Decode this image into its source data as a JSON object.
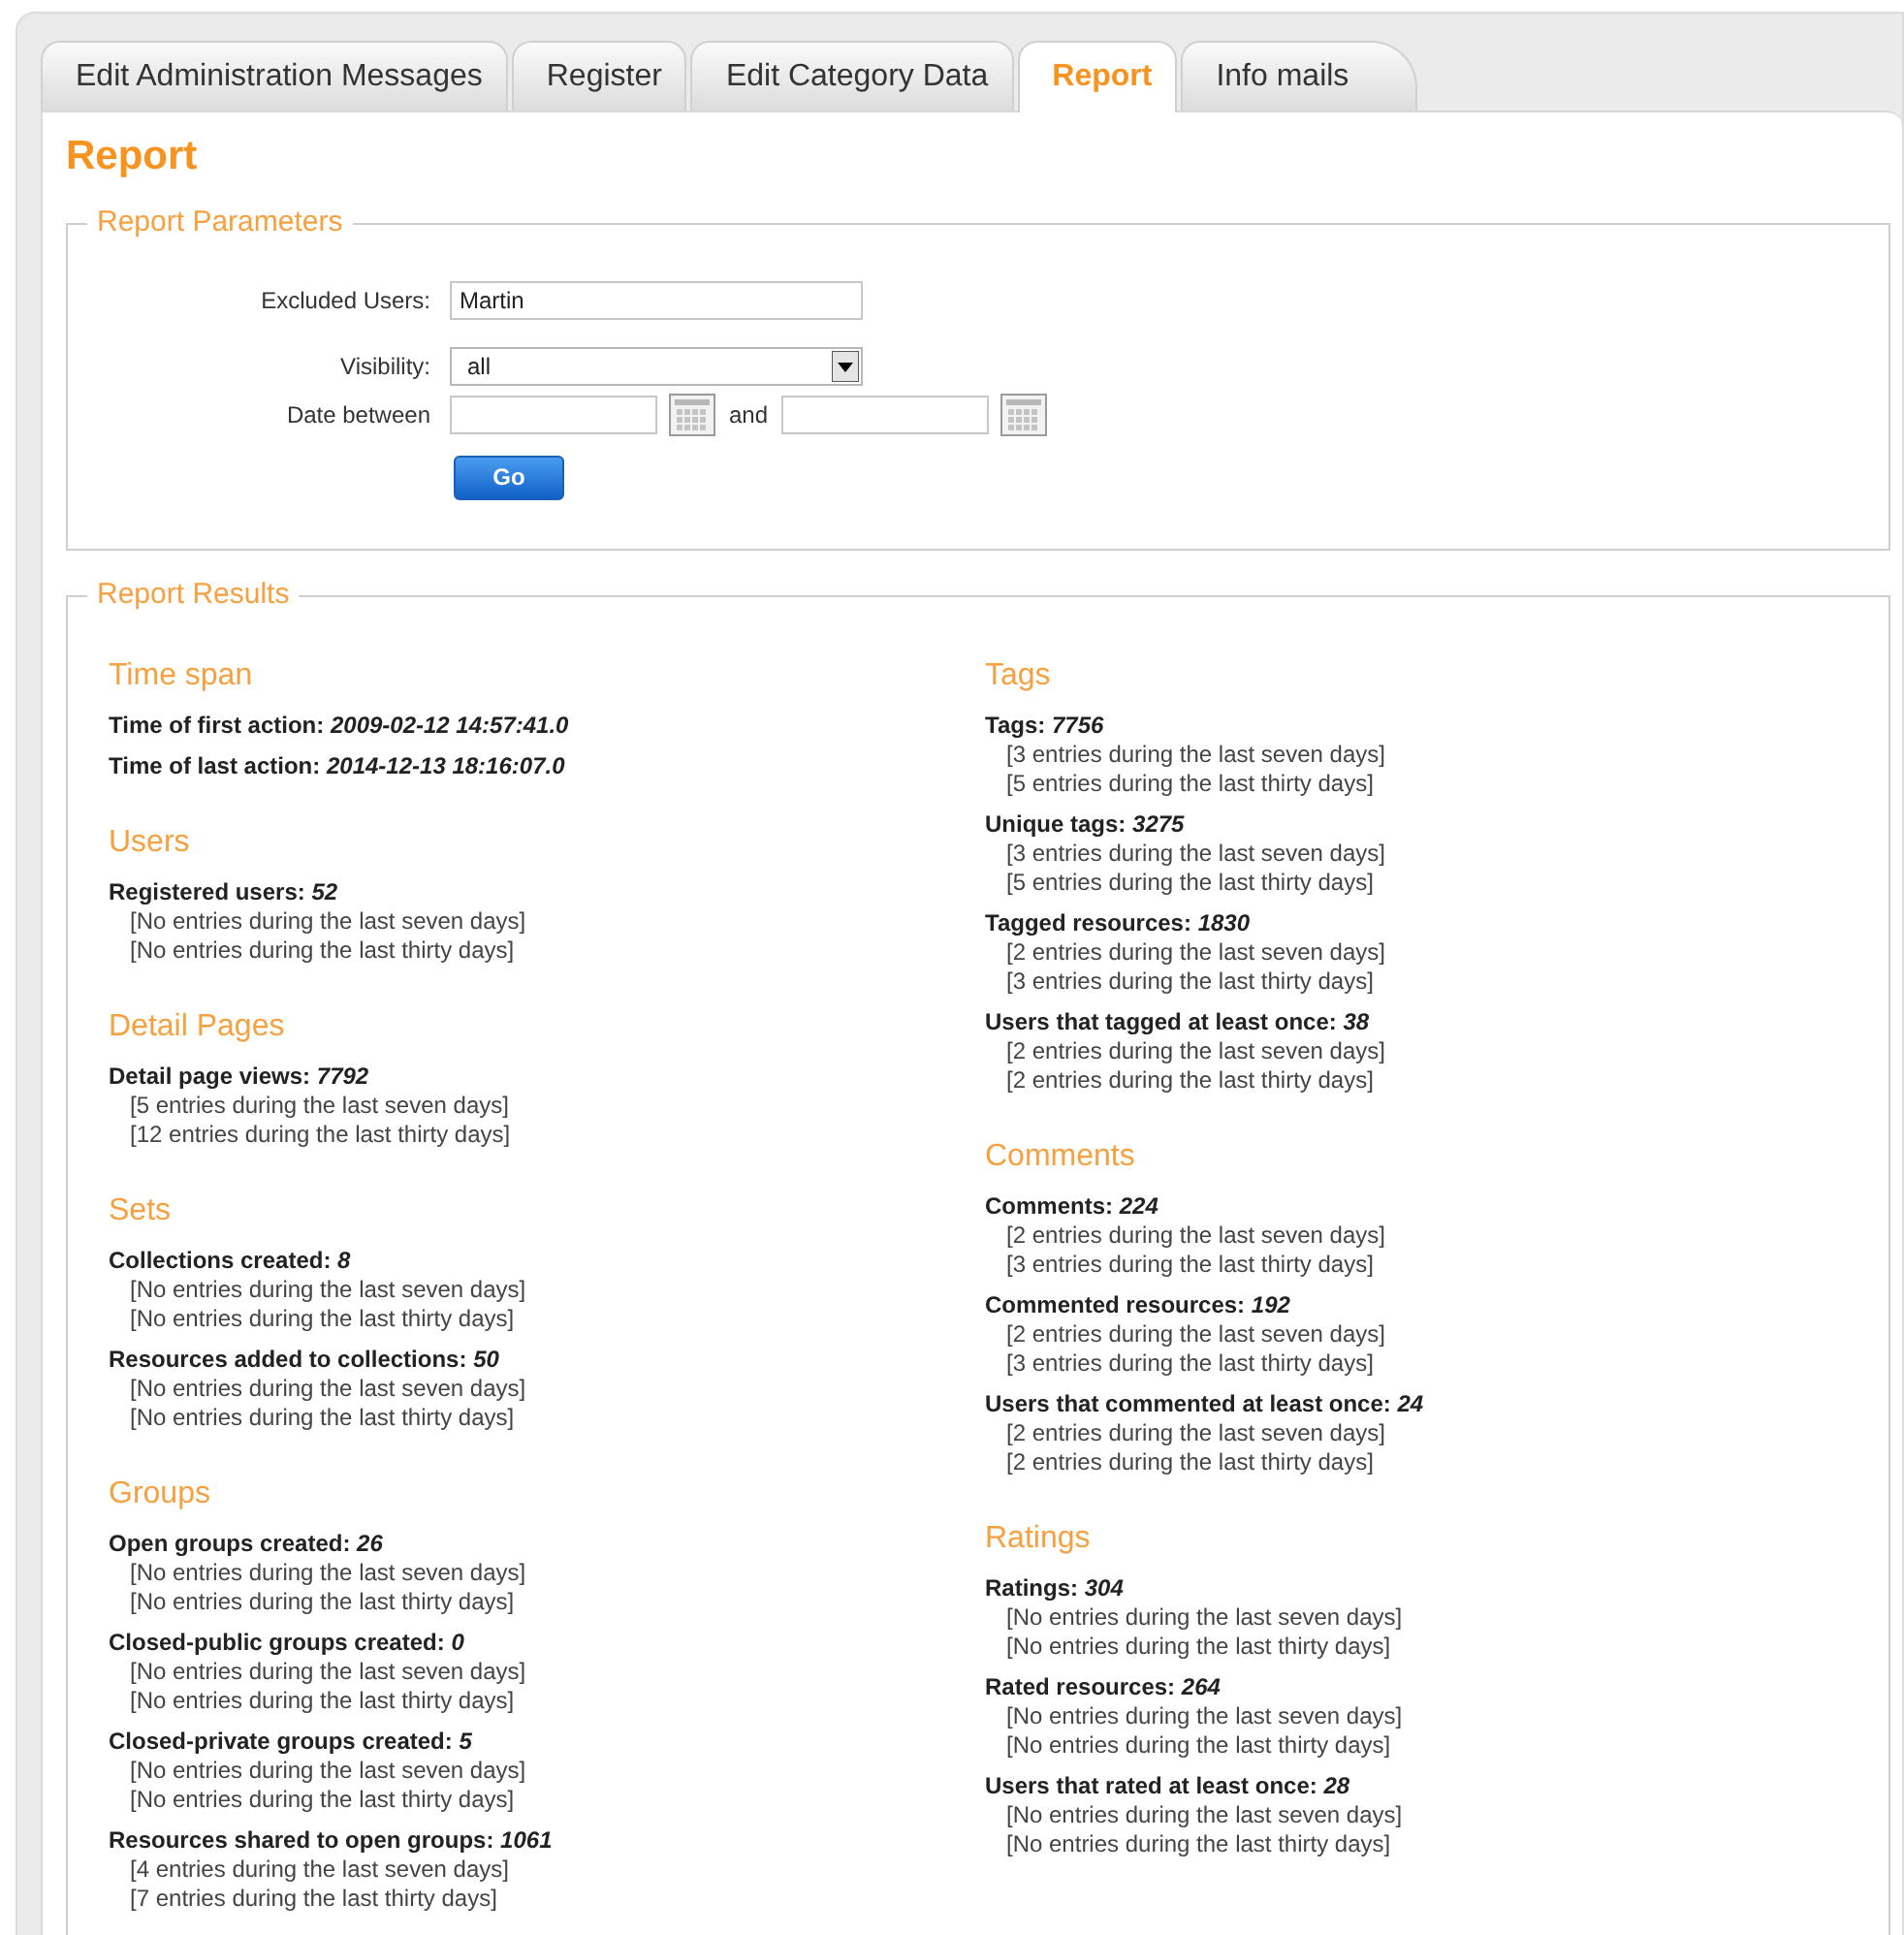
{
  "tabs": [
    {
      "label": "Edit Administration Messages",
      "selected": false
    },
    {
      "label": "Register",
      "selected": false
    },
    {
      "label": "Edit Category Data",
      "selected": false
    },
    {
      "label": "Report",
      "selected": true
    },
    {
      "label": "Info mails",
      "selected": false
    }
  ],
  "page_title": "Report",
  "parameters": {
    "legend": "Report Parameters",
    "excluded_users": {
      "label": "Excluded Users:",
      "value": "Martin"
    },
    "visibility": {
      "label": "Visibility:",
      "value": "all"
    },
    "date": {
      "label": "Date between",
      "joiner": "and"
    },
    "go_button": "Go"
  },
  "results": {
    "legend": "Report Results",
    "columns": [
      [
        {
          "title": "Time span",
          "stats": [
            {
              "label": "Time of first action:",
              "value": "2009-02-12 14:57:41.0"
            },
            {
              "label": "Time of last action:",
              "value": "2014-12-13 18:16:07.0"
            }
          ]
        },
        {
          "title": "Users",
          "stats": [
            {
              "label": "Registered users:",
              "value": "52",
              "lines": [
                "[No entries during the last seven days]",
                "[No entries during the last thirty days]"
              ]
            }
          ]
        },
        {
          "title": "Detail Pages",
          "stats": [
            {
              "label": "Detail page views:",
              "value": "7792",
              "lines": [
                "[5 entries during the last seven days]",
                "[12 entries during the last thirty days]"
              ]
            }
          ]
        },
        {
          "title": "Sets",
          "stats": [
            {
              "label": "Collections created:",
              "value": "8",
              "lines": [
                "[No entries during the last seven days]",
                "[No entries during the last thirty days]"
              ]
            },
            {
              "label": "Resources added to collections:",
              "value": "50",
              "lines": [
                "[No entries during the last seven days]",
                "[No entries during the last thirty days]"
              ]
            }
          ]
        },
        {
          "title": "Groups",
          "stats": [
            {
              "label": "Open groups created:",
              "value": "26",
              "lines": [
                "[No entries during the last seven days]",
                "[No entries during the last thirty days]"
              ]
            },
            {
              "label": "Closed-public groups created:",
              "value": "0",
              "lines": [
                "[No entries during the last seven days]",
                "[No entries during the last thirty days]"
              ]
            },
            {
              "label": "Closed-private groups created:",
              "value": "5",
              "lines": [
                "[No entries during the last seven days]",
                "[No entries during the last thirty days]"
              ]
            },
            {
              "label": "Resources shared to open groups:",
              "value": "1061",
              "lines": [
                "[4 entries during the last seven days]",
                "[7 entries during the last thirty days]"
              ]
            }
          ]
        }
      ],
      [
        {
          "title": "Tags",
          "stats": [
            {
              "label": "Tags:",
              "value": "7756",
              "lines": [
                "[3 entries during the last seven days]",
                "[5 entries during the last thirty days]"
              ]
            },
            {
              "label": "Unique tags:",
              "value": "3275",
              "lines": [
                "[3 entries during the last seven days]",
                "[5 entries during the last thirty days]"
              ]
            },
            {
              "label": "Tagged resources:",
              "value": "1830",
              "lines": [
                "[2 entries during the last seven days]",
                "[3 entries during the last thirty days]"
              ]
            },
            {
              "label": "Users that tagged at least once:",
              "value": "38",
              "lines": [
                "[2 entries during the last seven days]",
                "[2 entries during the last thirty days]"
              ]
            }
          ]
        },
        {
          "title": "Comments",
          "stats": [
            {
              "label": "Comments:",
              "value": "224",
              "lines": [
                "[2 entries during the last seven days]",
                "[3 entries during the last thirty days]"
              ]
            },
            {
              "label": "Commented resources:",
              "value": "192",
              "lines": [
                "[2 entries during the last seven days]",
                "[3 entries during the last thirty days]"
              ]
            },
            {
              "label": "Users that commented at least once:",
              "value": "24",
              "lines": [
                "[2 entries during the last seven days]",
                "[2 entries during the last thirty days]"
              ]
            }
          ]
        },
        {
          "title": "Ratings",
          "stats": [
            {
              "label": "Ratings:",
              "value": "304",
              "lines": [
                "[No entries during the last seven days]",
                "[No entries during the last thirty days]"
              ]
            },
            {
              "label": "Rated resources:",
              "value": "264",
              "lines": [
                "[No entries during the last seven days]",
                "[No entries during the last thirty days]"
              ]
            },
            {
              "label": "Users that rated at least once:",
              "value": "28",
              "lines": [
                "[No entries during the last seven days]",
                "[No entries during the last thirty days]"
              ]
            }
          ]
        }
      ]
    ]
  }
}
